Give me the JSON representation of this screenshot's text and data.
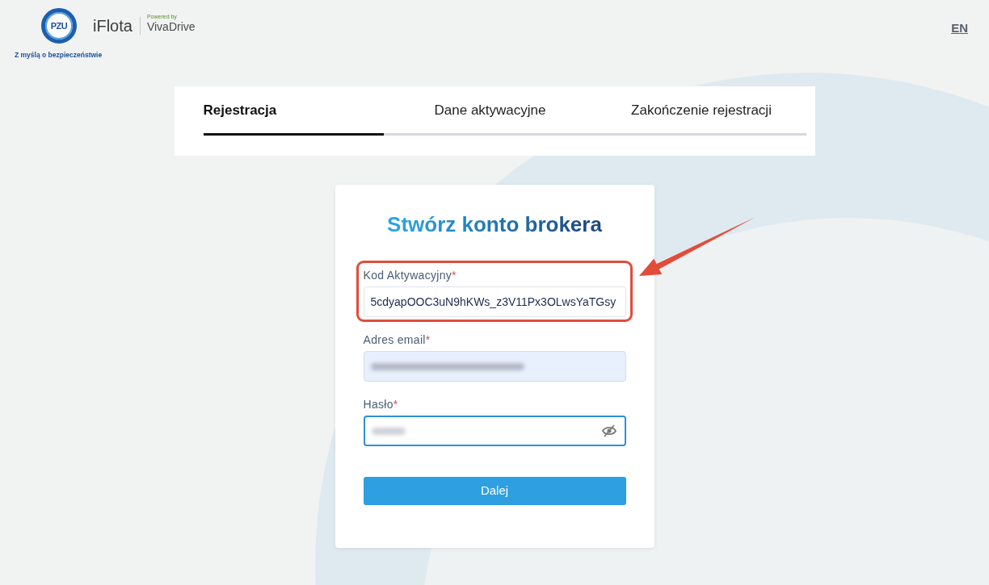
{
  "header": {
    "logo_mark": "PZU",
    "tagline": "Z myślą o bezpieczeństwie",
    "product": "iFlota",
    "powered_by": "Powered by",
    "partner": "VivaDrive",
    "language": "EN"
  },
  "steps": [
    {
      "label": "Rejestracja",
      "selected": true
    },
    {
      "label": "Dane aktywacyjne",
      "selected": false
    },
    {
      "label": "Zakończenie rejestracji",
      "selected": false
    }
  ],
  "form": {
    "title": "Stwórz konto brokera",
    "fields": [
      {
        "kind": "text",
        "label": "Kod Aktywacyjny",
        "required_mark": "*",
        "value": "5cdyapOOC3uN9hKWs_z3V11Px3OLwsYaTGsy",
        "obscured": false,
        "autofilled": false,
        "focused": false,
        "highlighted": true
      },
      {
        "kind": "email",
        "label": "Adres email",
        "required_mark": "*",
        "obscured": true,
        "autofilled": true,
        "focused": false,
        "highlighted": false
      },
      {
        "kind": "password",
        "label": "Hasło",
        "required_mark": "*",
        "obscured": true,
        "autofilled": false,
        "focused": true,
        "highlighted": false
      }
    ],
    "submit": "Dalej"
  }
}
